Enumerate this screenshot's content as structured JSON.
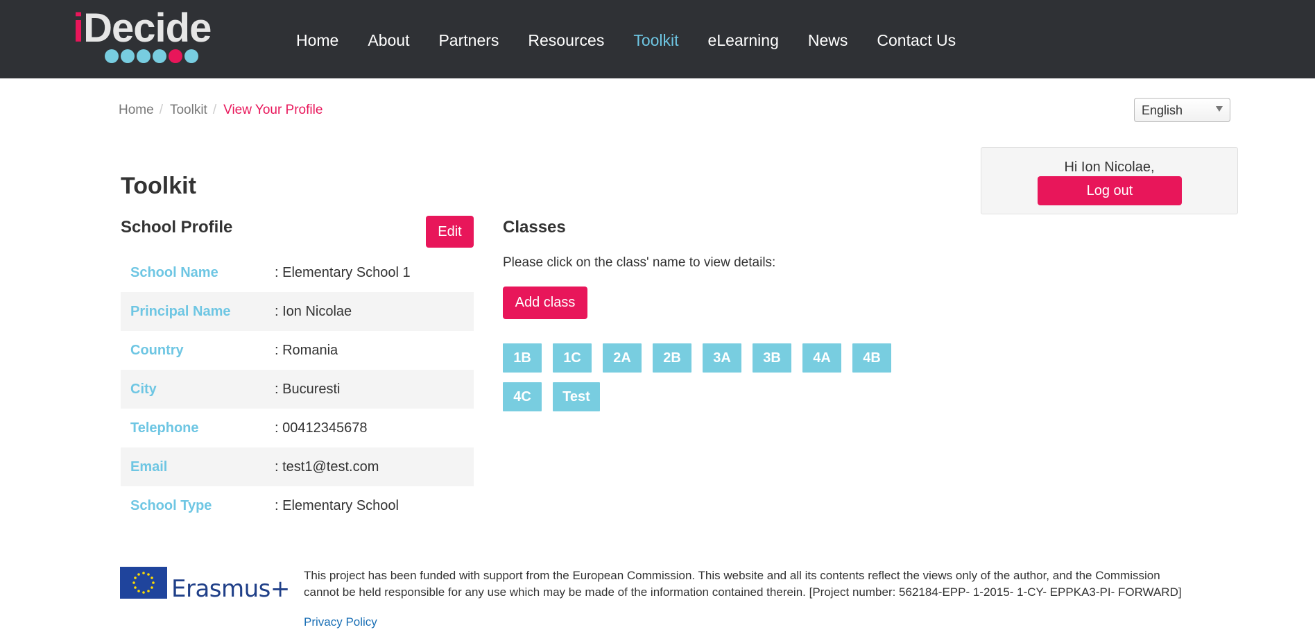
{
  "brand": {
    "logo_prefix": "i",
    "logo_rest": "Decide"
  },
  "nav": {
    "items": [
      {
        "label": "Home"
      },
      {
        "label": "About"
      },
      {
        "label": "Partners"
      },
      {
        "label": "Resources"
      },
      {
        "label": "Toolkit",
        "active": true
      },
      {
        "label": "eLearning"
      },
      {
        "label": "News"
      },
      {
        "label": "Contact Us"
      }
    ]
  },
  "breadcrumb": {
    "home": "Home",
    "toolkit": "Toolkit",
    "current": "View Your Profile",
    "separator": "/"
  },
  "language": {
    "selected": "English"
  },
  "user": {
    "greeting": "Hi Ion Nicolae,",
    "logout_label": "Log out"
  },
  "page": {
    "title": "Toolkit"
  },
  "profile": {
    "title": "School Profile",
    "edit_label": "Edit",
    "rows": [
      {
        "label": "School Name",
        "value": ": Elementary School 1"
      },
      {
        "label": "Principal Name",
        "value": ": Ion Nicolae"
      },
      {
        "label": "Country",
        "value": ": Romania"
      },
      {
        "label": "City",
        "value": ": Bucuresti"
      },
      {
        "label": "Telephone",
        "value": ": 00412345678"
      },
      {
        "label": "Email",
        "value": ": test1@test.com"
      },
      {
        "label": "School Type",
        "value": ": Elementary School"
      }
    ]
  },
  "classes": {
    "title": "Classes",
    "hint": "Please click on the class' name to view details:",
    "add_label": "Add class",
    "items": [
      "1B",
      "1C",
      "2A",
      "2B",
      "3A",
      "3B",
      "4A",
      "4B",
      "4C",
      "Test"
    ]
  },
  "footer": {
    "erasmus_label": "Erasmus+",
    "disclaimer": "This project has been funded with support from the European Commission. This website and all its contents reflect the views only of the author, and the Commission cannot be held responsible for any use which may be made of the information contained therein. [Project number: 562184-EPP- 1-2015- 1-CY- EPPKA3-PI- FORWARD]",
    "privacy_label": "Privacy Policy"
  },
  "colors": {
    "header_bg": "#2f3135",
    "accent_pink": "#e8165a",
    "accent_cyan": "#78cde0",
    "link_blue": "#1a6fb5"
  }
}
